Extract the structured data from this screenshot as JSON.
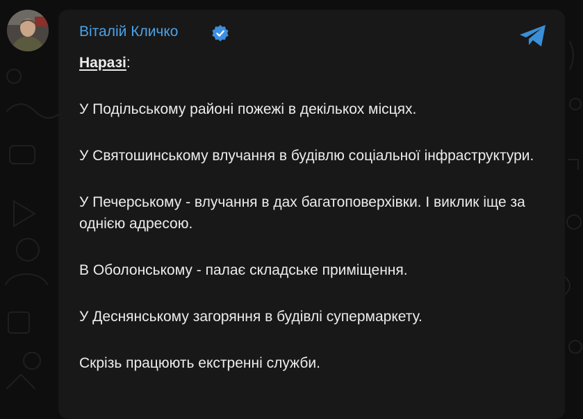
{
  "post": {
    "sender_name": "Віталій Кличко",
    "verified": true,
    "heading": "Наразі",
    "heading_suffix": ":",
    "paragraphs": [
      "У Подільському районі пожежі в декількох місцях.",
      "У Святошинському влучання в будівлю соціальної інфраструктури.",
      "У Печерському - влучання в дах багатоповерхівки. І виклик іще за однією адресою.",
      "В Оболонському - палає складське приміщення.",
      "У Деснянському загоряння в будівлі супермаркету.",
      "Скрізь працюють екстренні служби."
    ]
  },
  "icons": {
    "avatar": "avatar",
    "verified": "verified-badge-icon",
    "share": "telegram-paper-plane-icon"
  },
  "colors": {
    "background": "#0e0e0e",
    "bubble": "#181818",
    "sender": "#4ba2e8",
    "text": "#ececec",
    "verified_badge": "#3d8fe0",
    "telegram_icon": "#3a8fd6"
  }
}
